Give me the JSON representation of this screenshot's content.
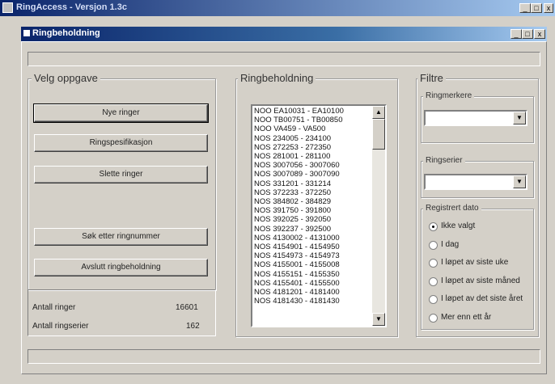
{
  "app": {
    "title": "RingAccess - Versjon 1.3c",
    "minimize": "_",
    "maximize": "□",
    "close": "x"
  },
  "window": {
    "title": "Ringbeholdning",
    "minimize": "_",
    "maximize": "□",
    "close": "x"
  },
  "tasks": {
    "title": "Velg oppgave",
    "buttons": {
      "new_rings": "Nye ringer",
      "ring_spec": "Ringspesifikasjon",
      "delete_rings": "Slette ringer",
      "search": "Søk etter ringnummer",
      "close": "Avslutt ringbeholdning"
    }
  },
  "stats": {
    "rings_label": "Antall ringer",
    "rings_value": "16601",
    "series_label": "Antall ringserier",
    "series_value": "162"
  },
  "inventory": {
    "title": "Ringbeholdning",
    "items": [
      "NOO EA10031 - EA10100",
      "NOO TB00751 - TB00850",
      "NOO VA459 - VA500",
      "NOS 234005 - 234100",
      "NOS 272253 - 272350",
      "NOS 281001 - 281100",
      "NOS 3007056 - 3007060",
      "NOS 3007089 - 3007090",
      "NOS 331201 - 331214",
      "NOS 372233 - 372250",
      "NOS 384802 - 384829",
      "NOS 391750 - 391800",
      "NOS 392025 - 392050",
      "NOS 392237 - 392500",
      "NOS 4130002 - 4131000",
      "NOS 4154901 - 4154950",
      "NOS 4154973 - 4154973",
      "NOS 4155001 - 4155008",
      "NOS 4155151 - 4155350",
      "NOS 4155401 - 4155500",
      "NOS 4181201 - 4181400",
      "NOS 4181430 - 4181430"
    ]
  },
  "filters": {
    "title": "Filtre",
    "ringmarker_label": "Ringmerkere",
    "ringmarker_value": "",
    "series_label": "Ringserier",
    "series_value": "",
    "date_label": "Registrert dato",
    "date_options": [
      "Ikke valgt",
      "I dag",
      "I løpet av siste uke",
      "I løpet av siste måned",
      "I løpet av det siste året",
      "Mer enn ett år"
    ],
    "date_selected": "Ikke valgt"
  },
  "icons": {
    "scroll_up": "scroll-up-arrow",
    "scroll_down": "scroll-down-arrow",
    "dropdown": "dropdown-arrow"
  }
}
